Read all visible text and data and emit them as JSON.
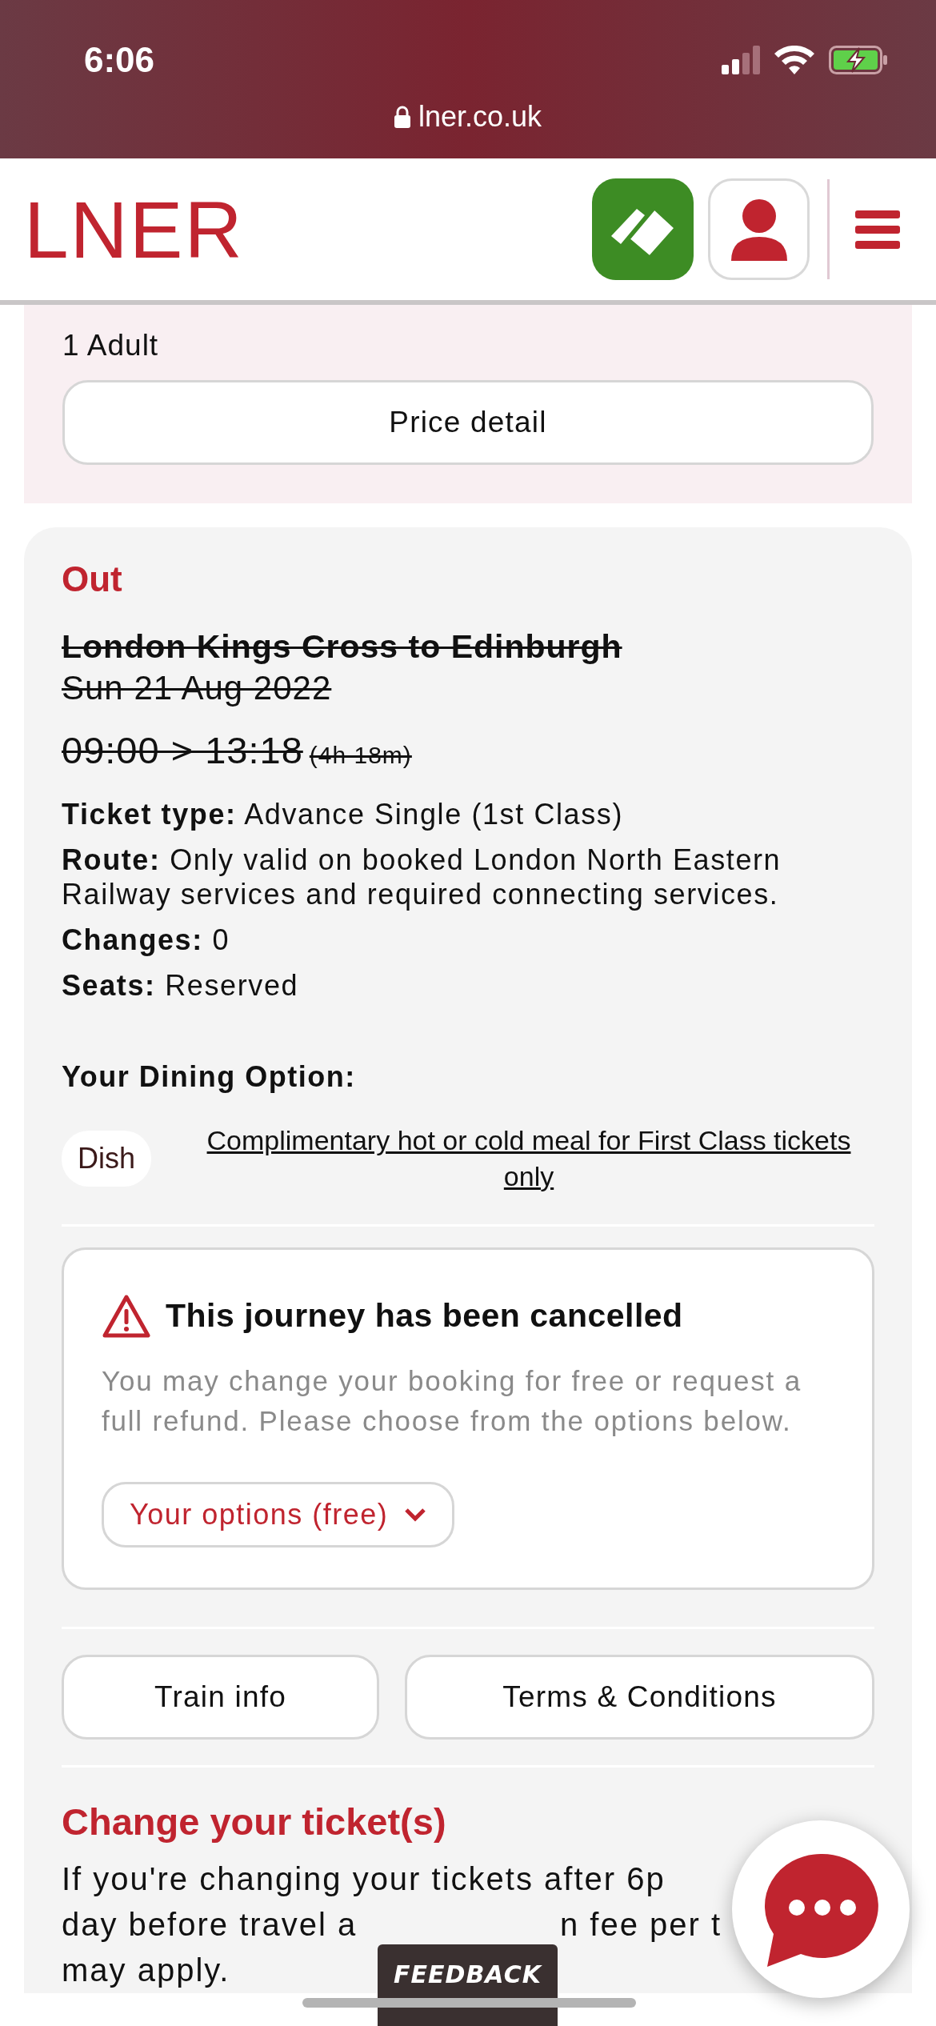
{
  "status_bar": {
    "time": "6:06",
    "url": "lner.co.uk"
  },
  "header": {
    "logo": "LNER"
  },
  "fare_summary": {
    "passengers": "1 Adult",
    "price_button": "Price detail"
  },
  "journey": {
    "direction": "Out",
    "cancelled": true,
    "route": "London Kings Cross to Edinburgh",
    "date": "Sun 21 Aug 2022",
    "times": "09:00 > 13:18",
    "duration": "(4h 18m)",
    "details": [
      "**Ticket type:** Advance Single (1st Class)",
      "**Route:** Only valid on booked London North Eastern Railway services and required connecting services.",
      "**Changes:** 0",
      "**Seats:** Reserved"
    ],
    "dining": {
      "heading": "Your Dining Option:",
      "chip": "Dish",
      "link": "Complimentary hot or cold meal for First Class tickets only"
    },
    "alert": {
      "title": "This journey has been cancelled",
      "message": "You may change your booking for free or request a full refund. Please choose from the options below.",
      "options_button": "Your options (free)",
      "expanded": false
    },
    "actions": [
      "Train info",
      "Terms & Conditions"
    ]
  },
  "change_section": {
    "heading": "Change your ticket(s)",
    "lines": [
      [
        "If you're changing your tickets after 6p"
      ],
      [
        "day before travel a",
        "n fee per t"
      ],
      [
        "may apply."
      ]
    ]
  },
  "feedback_tab": "FEEDBACK"
}
